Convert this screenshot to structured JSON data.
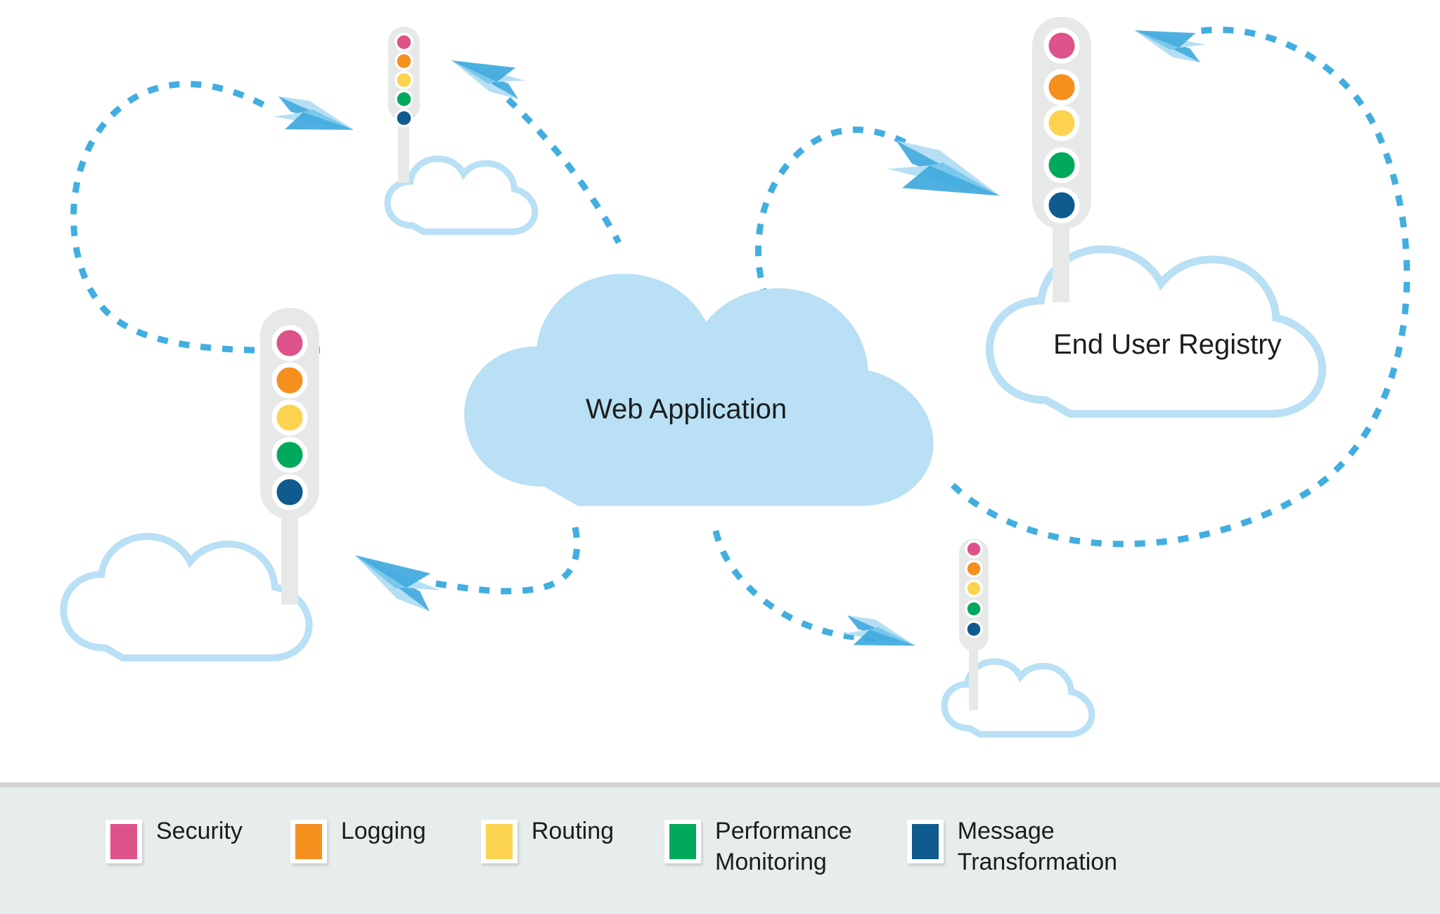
{
  "diagram": {
    "background_color": "#ffffff",
    "nodes": [
      {
        "id": "web-application",
        "label": "Web Application",
        "shape": "cloud-filled",
        "fill": "#b9e0f4"
      },
      {
        "id": "end-user-registry",
        "label": "End User Registry",
        "shape": "cloud-outline",
        "stroke": "#b9e0f4"
      },
      {
        "id": "cloud-top-left",
        "label": "",
        "shape": "cloud-outline",
        "stroke": "#b9e0f4"
      },
      {
        "id": "cloud-bottom-left",
        "label": "",
        "shape": "cloud-outline",
        "stroke": "#b9e0f4"
      },
      {
        "id": "cloud-bottom-right",
        "label": "",
        "shape": "cloud-outline",
        "stroke": "#b9e0f4"
      }
    ],
    "gateways": [
      {
        "id": "gateway-top-left",
        "size": "small"
      },
      {
        "id": "gateway-left",
        "size": "large"
      },
      {
        "id": "gateway-top-right",
        "size": "large"
      },
      {
        "id": "gateway-bottom-right",
        "size": "xsmall"
      }
    ],
    "gateway_light_colors": [
      "#dd5289",
      "#f5901e",
      "#fcd34f",
      "#00a95c",
      "#0f5b8e"
    ],
    "gateway_body_color": "#e7e9e9",
    "connector": {
      "style": "dotted",
      "color": "#42aee0",
      "dash": "14 14",
      "width": 9
    },
    "plane": {
      "light_fill": "#b6dff4",
      "mid_fill": "#7ac8ec",
      "dark_fill": "#3fa9dd"
    }
  },
  "legend": {
    "background_color": "#e7ecec",
    "border_color": "#d2d2d2",
    "items": [
      {
        "label": "Security",
        "color": "#dd5289"
      },
      {
        "label": "Logging",
        "color": "#f5901e"
      },
      {
        "label": "Routing",
        "color": "#fcd34f"
      },
      {
        "label": "Performance\nMonitoring",
        "color": "#00a95c"
      },
      {
        "label": "Message\nTransformation",
        "color": "#0f5b8e"
      }
    ]
  }
}
